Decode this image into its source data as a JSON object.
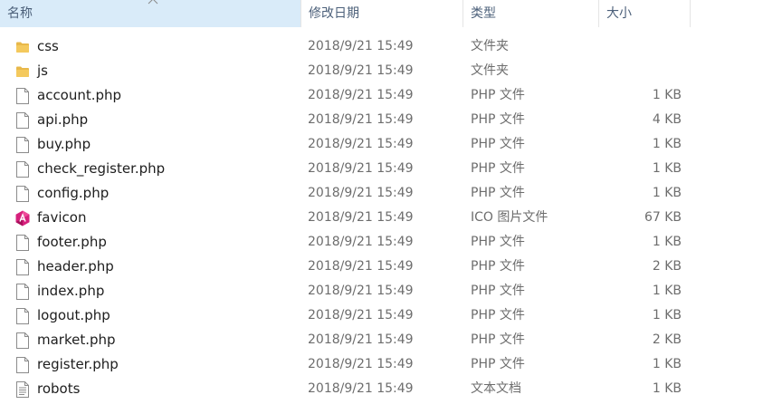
{
  "columns": {
    "name": "名称",
    "date": "修改日期",
    "type": "类型",
    "size": "大小"
  },
  "files": [
    {
      "icon": "folder-icon",
      "name": "css",
      "date": "2018/9/21 15:49",
      "type": "文件夹",
      "size": ""
    },
    {
      "icon": "folder-icon",
      "name": "js",
      "date": "2018/9/21 15:49",
      "type": "文件夹",
      "size": ""
    },
    {
      "icon": "file-icon",
      "name": "account.php",
      "date": "2018/9/21 15:49",
      "type": "PHP 文件",
      "size": "1 KB"
    },
    {
      "icon": "file-icon",
      "name": "api.php",
      "date": "2018/9/21 15:49",
      "type": "PHP 文件",
      "size": "4 KB"
    },
    {
      "icon": "file-icon",
      "name": "buy.php",
      "date": "2018/9/21 15:49",
      "type": "PHP 文件",
      "size": "1 KB"
    },
    {
      "icon": "file-icon",
      "name": "check_register.php",
      "date": "2018/9/21 15:49",
      "type": "PHP 文件",
      "size": "1 KB"
    },
    {
      "icon": "file-icon",
      "name": "config.php",
      "date": "2018/9/21 15:49",
      "type": "PHP 文件",
      "size": "1 KB"
    },
    {
      "icon": "favicon-icon",
      "name": "favicon",
      "date": "2018/9/21 15:49",
      "type": "ICO 图片文件",
      "size": "67 KB"
    },
    {
      "icon": "file-icon",
      "name": "footer.php",
      "date": "2018/9/21 15:49",
      "type": "PHP 文件",
      "size": "1 KB"
    },
    {
      "icon": "file-icon",
      "name": "header.php",
      "date": "2018/9/21 15:49",
      "type": "PHP 文件",
      "size": "2 KB"
    },
    {
      "icon": "file-icon",
      "name": "index.php",
      "date": "2018/9/21 15:49",
      "type": "PHP 文件",
      "size": "1 KB"
    },
    {
      "icon": "file-icon",
      "name": "logout.php",
      "date": "2018/9/21 15:49",
      "type": "PHP 文件",
      "size": "1 KB"
    },
    {
      "icon": "file-icon",
      "name": "market.php",
      "date": "2018/9/21 15:49",
      "type": "PHP 文件",
      "size": "2 KB"
    },
    {
      "icon": "file-icon",
      "name": "register.php",
      "date": "2018/9/21 15:49",
      "type": "PHP 文件",
      "size": "1 KB"
    },
    {
      "icon": "text-file-icon",
      "name": "robots",
      "date": "2018/9/21 15:49",
      "type": "文本文档",
      "size": "1 KB"
    }
  ],
  "colors": {
    "folder": "#e8b84a",
    "favicon": "#d6207c",
    "header_text": "#4c607a",
    "detail_text": "#6d6d6d"
  }
}
